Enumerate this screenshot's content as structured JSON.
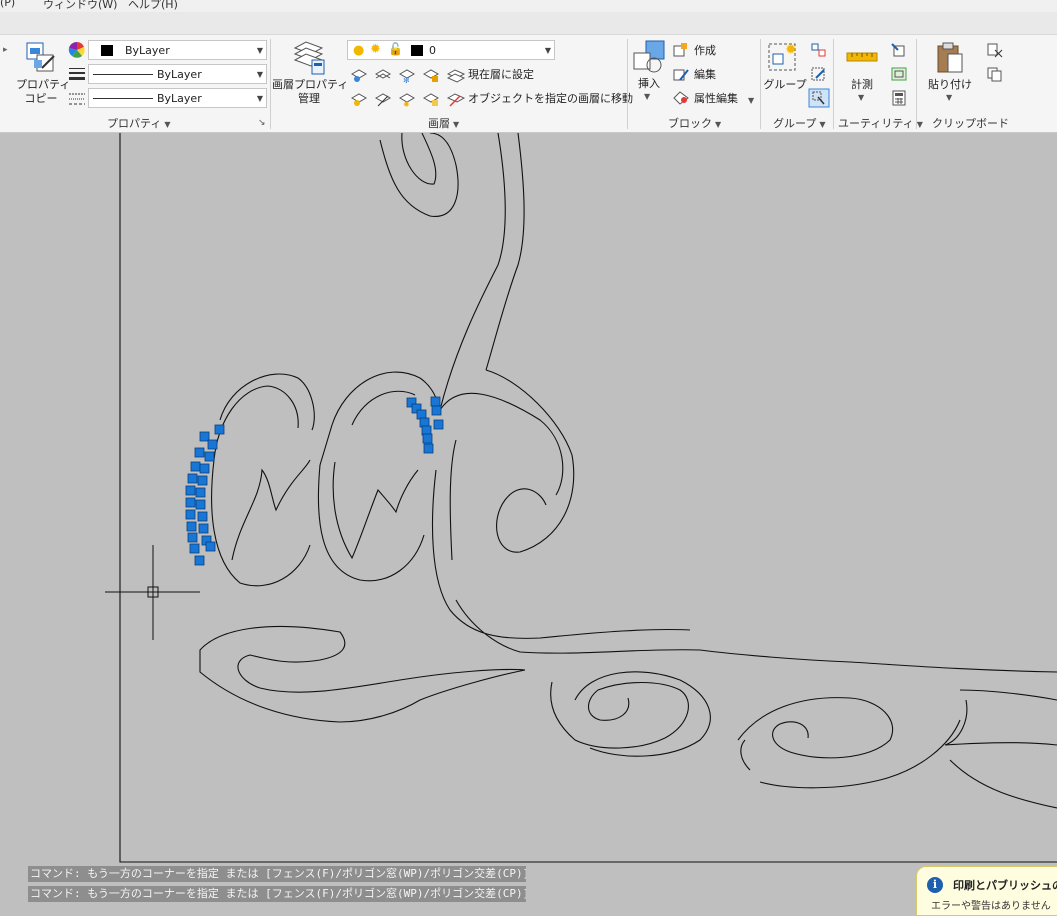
{
  "menu": {
    "items": [
      "(P)",
      "ウィンドウ(W)",
      "ヘルプ(H)"
    ]
  },
  "ribbon": {
    "properties": {
      "match_label_line1": "プロパティ",
      "match_label_line2": "コピー",
      "color_value": "ByLayer",
      "lineweight_value": "ByLayer",
      "linetype_value": "ByLayer",
      "panel_title": "プロパティ"
    },
    "layers": {
      "manager_line1": "画層プロパティ",
      "manager_line2": "管理",
      "current_layer": "0",
      "set_current": "現在層に設定",
      "move_to_layer": "オブジェクトを指定の画層に移動",
      "panel_title": "画層"
    },
    "block": {
      "insert": "挿入",
      "create": "作成",
      "edit": "編集",
      "attr_edit": "属性編集",
      "panel_title": "ブロック"
    },
    "groups": {
      "group": "グループ",
      "panel_title": "グループ"
    },
    "utilities": {
      "measure": "計測",
      "panel_title": "ユーティリティ"
    },
    "clipboard": {
      "paste": "貼り付け",
      "panel_title": "クリップボード"
    }
  },
  "command_history": [
    "コマンド: もう一方のコーナーを指定 または [フェンス(F)/ポリゴン窓(WP)/ポリゴン交差(CP)]:",
    "コマンド: もう一方のコーナーを指定 または [フェンス(F)/ポリゴン窓(WP)/ポリゴン交差(CP)]:"
  ],
  "notification": {
    "title": "印刷とパブリッシュのジ",
    "body": "エラーや警告はありません"
  },
  "colors": {
    "grip": "#1877d6",
    "canvas": "#bfbfbf",
    "ribbon": "#f5f5f5",
    "accent": "#1e5fb0"
  }
}
